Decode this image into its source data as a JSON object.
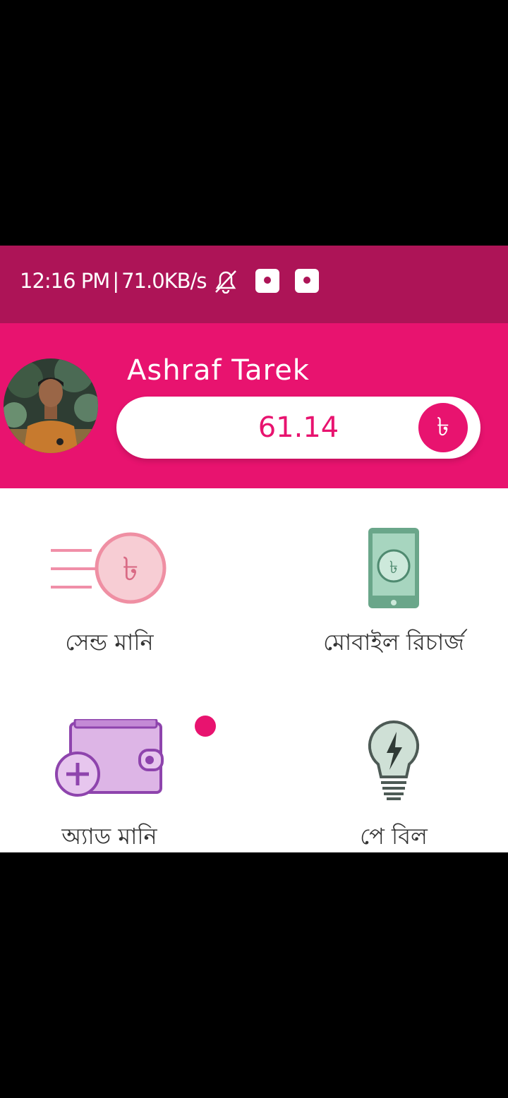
{
  "status_bar": {
    "time": "12:16 PM",
    "separator": "|",
    "network_speed": "71.0KB/s",
    "icons": [
      "bell-off-icon",
      "download-icon",
      "download-icon"
    ]
  },
  "header": {
    "user_name": "Ashraf Tarek",
    "balance": "61.14",
    "currency_symbol": "৳"
  },
  "services": [
    {
      "label": "সেন্ড মানি",
      "icon": "send-money-icon"
    },
    {
      "label": "মোবাইল রিচার্জ",
      "icon": "mobile-recharge-icon"
    },
    {
      "label": "অ্যাড মানি",
      "icon": "add-money-wallet-icon"
    },
    {
      "label": "পে বিল",
      "icon": "pay-bill-bulb-icon"
    }
  ],
  "colors": {
    "status_bar": "#ad1457",
    "primary": "#e8136f",
    "background": "#ffffff",
    "letterbox": "#000000"
  }
}
